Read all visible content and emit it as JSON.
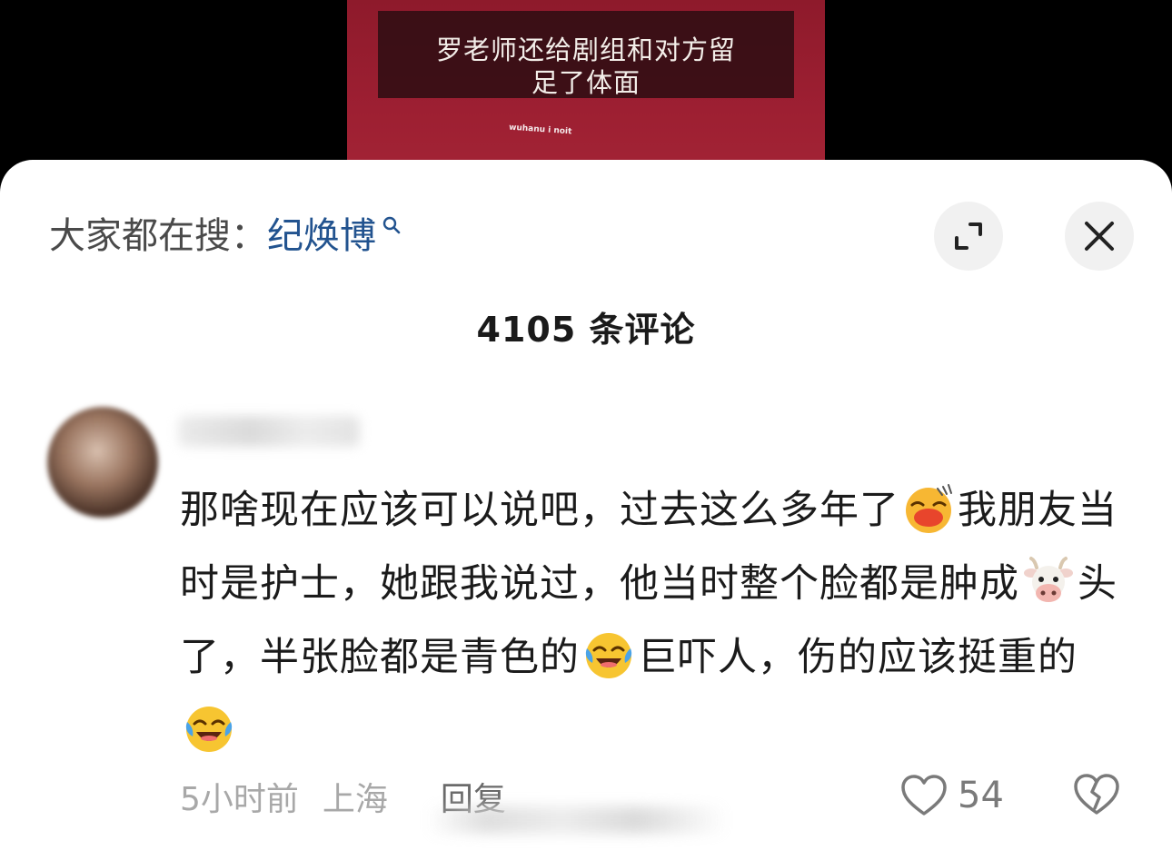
{
  "video": {
    "subtitle_line1": "罗老师还给剧组和对方留",
    "subtitle_line2": "足了体面",
    "watermark": "wuhanu i noit"
  },
  "search": {
    "prefix": "大家都在搜：",
    "keyword": "纪焕博"
  },
  "comments": {
    "count_label": "4105 条评论",
    "item": {
      "text_1": "那啥现在应该可以说吧，过去这么多年了",
      "text_2": "我朋友当时是护士，她跟我说过，他当时整个脸都是肿成",
      "text_3": "头了，半张脸都是青色的",
      "text_4": "巨吓人，伤的应该挺重的",
      "emojis": [
        "sweat-smile-emoji",
        "cow-emoji",
        "laugh-cry-emoji",
        "laugh-cry-emoji"
      ],
      "time": "5小时前",
      "location": "上海",
      "reply_label": "回复",
      "likes": "54"
    }
  },
  "colors": {
    "keyword": "#22538f",
    "video_bg": "#9d1f32",
    "sheet_bg": "#ffffff"
  }
}
